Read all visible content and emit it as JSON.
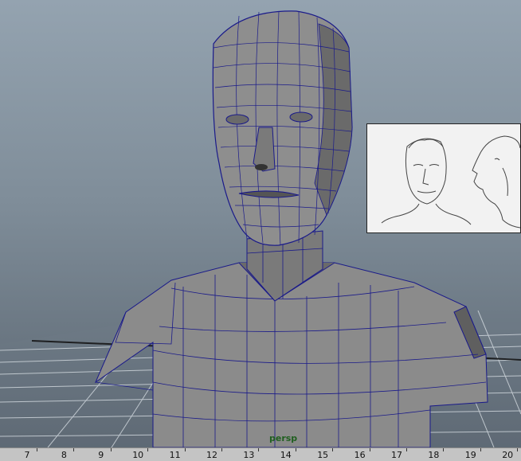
{
  "viewport": {
    "camera_label": "persp",
    "model": "head-bust-mesh",
    "reference": "face-sketch-front-and-profile"
  },
  "timeline": {
    "ticks": [
      "7",
      "8",
      "9",
      "10",
      "11",
      "12",
      "13",
      "14",
      "15",
      "16",
      "17",
      "18",
      "19",
      "20"
    ]
  },
  "colors": {
    "wire": "#1a1a8a",
    "mesh_fill": "#8b8b8b",
    "mesh_shadow": "#5f5f5f",
    "grid": "#cfd6dc",
    "label": "#1f5f1f"
  }
}
